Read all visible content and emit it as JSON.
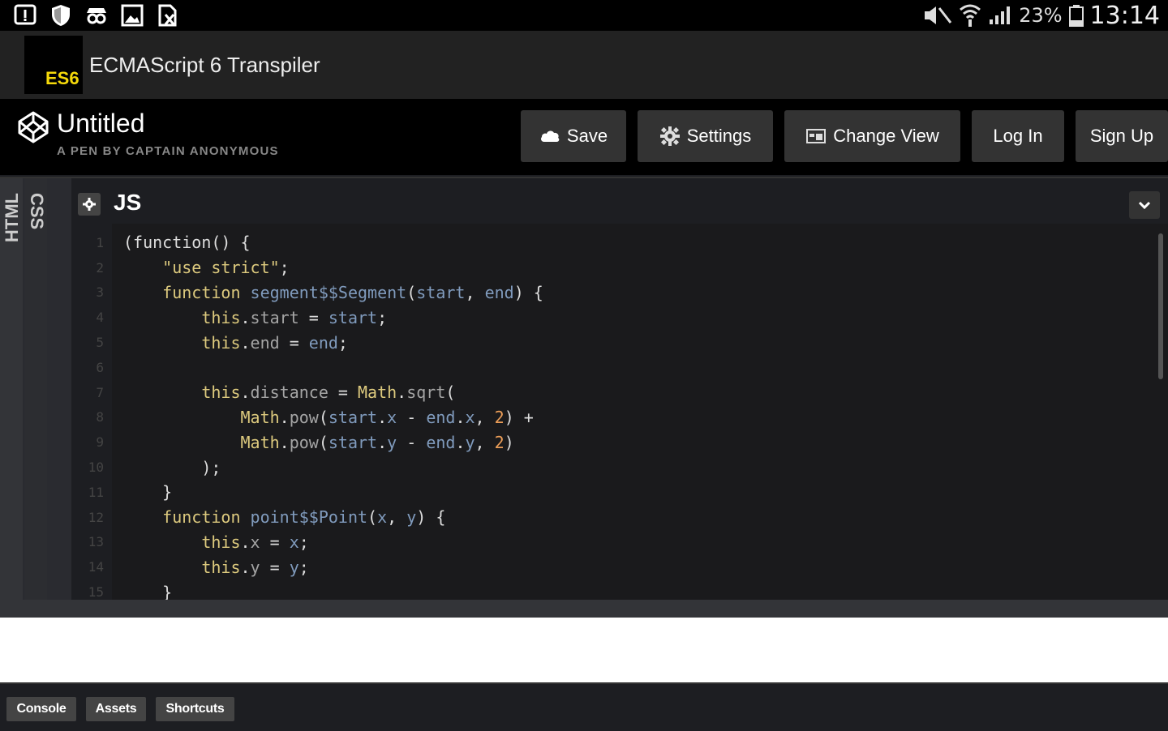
{
  "statusbar": {
    "left_icons": [
      "alert-icon",
      "shield-icon",
      "incognito-icon",
      "image-icon",
      "file-icon"
    ],
    "battery_percent": "23%",
    "time": "13:14"
  },
  "app": {
    "logo_text": "ES6",
    "title": "ECMAScript 6 Transpiler"
  },
  "pen": {
    "title": "Untitled",
    "byline": "A PEN BY CAPTAIN ANONYMOUS"
  },
  "toolbar": {
    "save_label": "Save",
    "settings_label": "Settings",
    "change_view_label": "Change View",
    "login_label": "Log In",
    "signup_label": "Sign Up"
  },
  "editor": {
    "tabs": {
      "html": "HTML",
      "css": "CSS"
    },
    "js_label": "JS",
    "lines": [
      [
        [
          "p",
          "(function() {"
        ]
      ],
      [
        [
          "p",
          "    "
        ],
        [
          "s",
          "\"use strict\""
        ],
        [
          "p",
          ";"
        ]
      ],
      [
        [
          "p",
          "    "
        ],
        [
          "k",
          "function"
        ],
        [
          "p",
          " "
        ],
        [
          "f",
          "segment$$Segment"
        ],
        [
          "p",
          "("
        ],
        [
          "f",
          "start"
        ],
        [
          "p",
          ", "
        ],
        [
          "f",
          "end"
        ],
        [
          "p",
          ") {"
        ]
      ],
      [
        [
          "p",
          "        "
        ],
        [
          "k",
          "this"
        ],
        [
          "p",
          "."
        ],
        [
          "r",
          "start"
        ],
        [
          "p",
          " = "
        ],
        [
          "f",
          "start"
        ],
        [
          "p",
          ";"
        ]
      ],
      [
        [
          "p",
          "        "
        ],
        [
          "k",
          "this"
        ],
        [
          "p",
          "."
        ],
        [
          "r",
          "end"
        ],
        [
          "p",
          " = "
        ],
        [
          "f",
          "end"
        ],
        [
          "p",
          ";"
        ]
      ],
      [
        [
          "p",
          ""
        ]
      ],
      [
        [
          "p",
          "        "
        ],
        [
          "k",
          "this"
        ],
        [
          "p",
          "."
        ],
        [
          "r",
          "distance"
        ],
        [
          "p",
          " = "
        ],
        [
          "k",
          "Math"
        ],
        [
          "p",
          "."
        ],
        [
          "r",
          "sqrt"
        ],
        [
          "p",
          "("
        ]
      ],
      [
        [
          "p",
          "            "
        ],
        [
          "k",
          "Math"
        ],
        [
          "p",
          "."
        ],
        [
          "r",
          "pow"
        ],
        [
          "p",
          "("
        ],
        [
          "f",
          "start"
        ],
        [
          "p",
          "."
        ],
        [
          "f",
          "x"
        ],
        [
          "p",
          " - "
        ],
        [
          "f",
          "end"
        ],
        [
          "p",
          "."
        ],
        [
          "f",
          "x"
        ],
        [
          "p",
          ", "
        ],
        [
          "n",
          "2"
        ],
        [
          "p",
          ") +"
        ]
      ],
      [
        [
          "p",
          "            "
        ],
        [
          "k",
          "Math"
        ],
        [
          "p",
          "."
        ],
        [
          "r",
          "pow"
        ],
        [
          "p",
          "("
        ],
        [
          "f",
          "start"
        ],
        [
          "p",
          "."
        ],
        [
          "f",
          "y"
        ],
        [
          "p",
          " - "
        ],
        [
          "f",
          "end"
        ],
        [
          "p",
          "."
        ],
        [
          "f",
          "y"
        ],
        [
          "p",
          ", "
        ],
        [
          "n",
          "2"
        ],
        [
          "p",
          ")"
        ]
      ],
      [
        [
          "p",
          "        );"
        ]
      ],
      [
        [
          "p",
          "    }"
        ]
      ],
      [
        [
          "p",
          "    "
        ],
        [
          "k",
          "function"
        ],
        [
          "p",
          " "
        ],
        [
          "f",
          "point$$Point"
        ],
        [
          "p",
          "("
        ],
        [
          "f",
          "x"
        ],
        [
          "p",
          ", "
        ],
        [
          "f",
          "y"
        ],
        [
          "p",
          ") {"
        ]
      ],
      [
        [
          "p",
          "        "
        ],
        [
          "k",
          "this"
        ],
        [
          "p",
          "."
        ],
        [
          "r",
          "x"
        ],
        [
          "p",
          " = "
        ],
        [
          "f",
          "x"
        ],
        [
          "p",
          ";"
        ]
      ],
      [
        [
          "p",
          "        "
        ],
        [
          "k",
          "this"
        ],
        [
          "p",
          "."
        ],
        [
          "r",
          "y"
        ],
        [
          "p",
          " = "
        ],
        [
          "f",
          "y"
        ],
        [
          "p",
          ";"
        ]
      ],
      [
        [
          "p",
          "    }"
        ]
      ]
    ]
  },
  "footer": {
    "console_label": "Console",
    "assets_label": "Assets",
    "shortcuts_label": "Shortcuts"
  },
  "colors": {
    "keyword": "#ddca7e",
    "identifier": "#809bbd",
    "property": "#a5a5a5",
    "number": "#ec9e58",
    "logo_text": "#f5d90a"
  }
}
